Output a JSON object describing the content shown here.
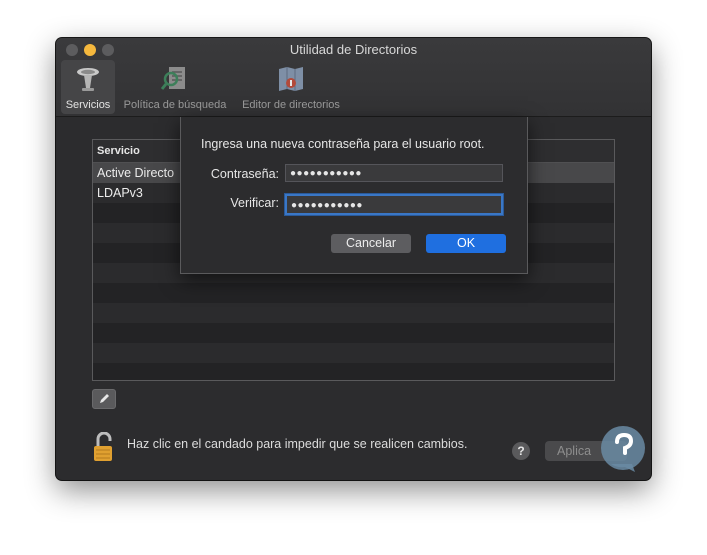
{
  "window": {
    "title": "Utilidad de Directorios"
  },
  "toolbar": {
    "items": [
      {
        "label": "Servicios",
        "icon": "services-icon",
        "active": true
      },
      {
        "label": "Política de búsqueda",
        "icon": "search-policy-icon",
        "active": false
      },
      {
        "label": "Editor de directorios",
        "icon": "directory-editor-icon",
        "active": false
      }
    ]
  },
  "services_table": {
    "header": "Servicio",
    "rows": [
      "Active Directo",
      "LDAPv3"
    ]
  },
  "footer": {
    "lock_text": "Haz clic en el candado para impedir que se realicen cambios.",
    "help_label": "?",
    "apply_label": "Aplica"
  },
  "dialog": {
    "message": "Ingresa una nueva contraseña para el usuario root.",
    "password_label": "Contraseña:",
    "password_value": "●●●●●●●●●●●",
    "verify_label": "Verificar:",
    "verify_value": "●●●●●●●●●●●",
    "cancel_label": "Cancelar",
    "ok_label": "OK"
  },
  "colors": {
    "accent": "#1f6fe0",
    "focus_ring": "#3a77c6",
    "window_bg": "#2c2c2e",
    "traffic_minimize": "#f5b83d",
    "lock_icon": "#e0a030"
  }
}
